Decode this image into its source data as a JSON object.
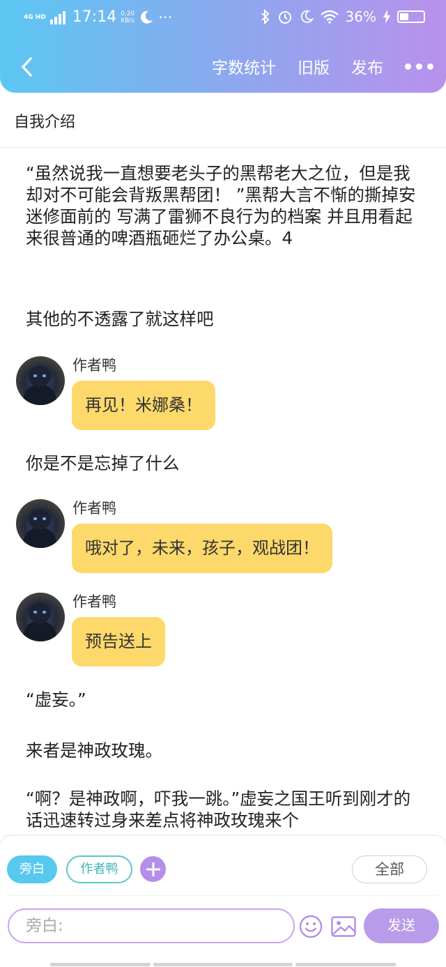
{
  "status_bar": {
    "network": "4G HD",
    "time": "17:14",
    "speed_value": "0.20",
    "speed_unit": "KB/s",
    "more": "···",
    "battery": "36%"
  },
  "nav": {
    "word_count": "字数统计",
    "old_version": "旧版",
    "publish": "发布"
  },
  "chapter_title": "自我介绍",
  "story": {
    "p1": "“虽然说我一直想要老头子的黑帮老大之位，但是我却对不可能会背叛黑帮团！ ”黑帮大言不惭的撕掉安迷修面前的 写满了雷狮不良行为的档案 并且用看起来很普通的啤酒瓶砸烂了办公桌。4",
    "p2": "其他的不透露了就这样吧",
    "msg1_name": "作者鸭",
    "msg1_text": "再见！米娜桑！",
    "p3": "你是不是忘掉了什么",
    "msg2_name": "作者鸭",
    "msg2_text": "哦对了，未来，孩子，观战团！",
    "msg3_name": "作者鸭",
    "msg3_text": "预告送上",
    "p4": "“虚妄。”",
    "p5": "来者是神政玫瑰。",
    "p6": "“啊？是神政啊，吓我一跳。”虚妄之国王听到刚才的话迅速转过身来差点将神政玫瑰来个"
  },
  "composer": {
    "role_narrator": "旁白",
    "role_author": "作者鸭",
    "filter_all": "全部",
    "input_placeholder": "旁白:",
    "send": "发送"
  },
  "colors": {
    "header_start": "#5bc7f2",
    "header_end": "#b991ec",
    "bubble": "#fdd96b",
    "accent_purple": "#b48ee8",
    "narrator_chip": "#58c9ee"
  }
}
